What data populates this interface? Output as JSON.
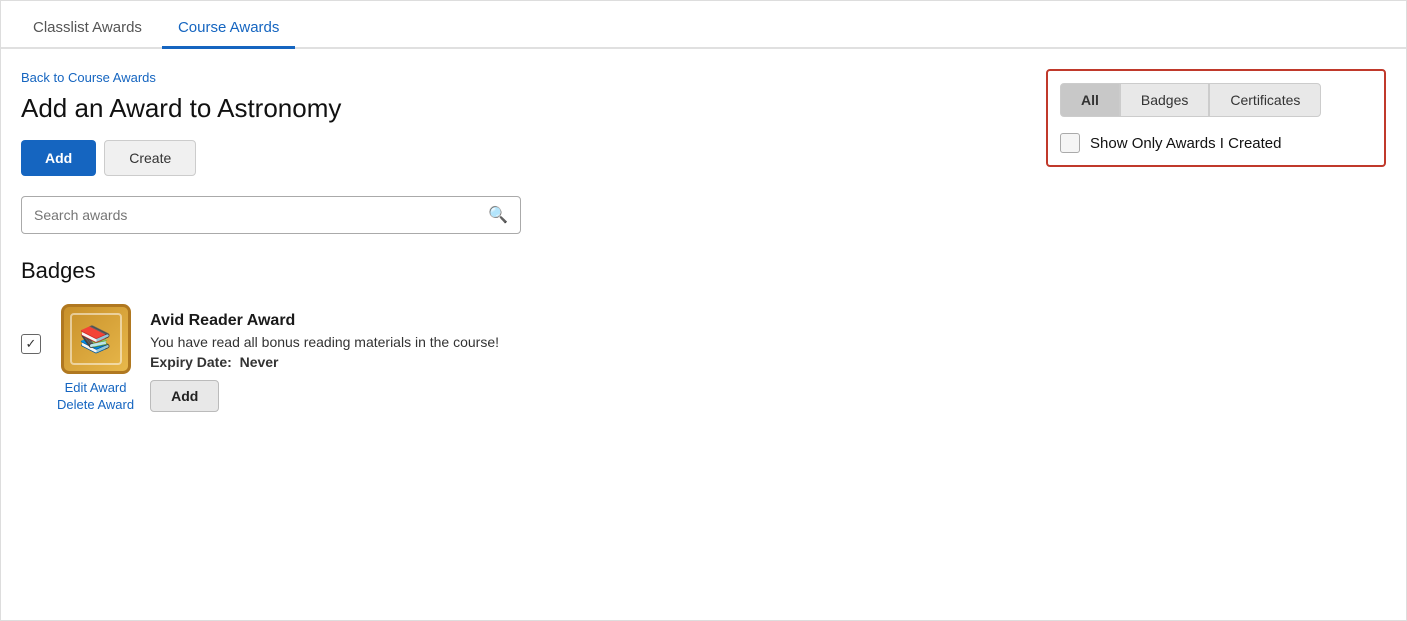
{
  "tabs": [
    {
      "id": "classlist",
      "label": "Classlist Awards",
      "active": false
    },
    {
      "id": "course",
      "label": "Course Awards",
      "active": true
    }
  ],
  "breadcrumb": {
    "back_label": "Back to Course Awards"
  },
  "page_title": "Add an Award to Astronomy",
  "action_buttons": {
    "add_label": "Add",
    "create_label": "Create"
  },
  "search": {
    "placeholder": "Search awards"
  },
  "badges_section": {
    "title": "Badges",
    "items": [
      {
        "id": "avid-reader",
        "checked": true,
        "name": "Avid Reader Award",
        "description": "You have read all bonus reading materials in the course!",
        "expiry_label": "Expiry Date:",
        "expiry_value": "Never",
        "edit_link": "Edit Award",
        "delete_link": "Delete Award",
        "add_button": "Add"
      }
    ]
  },
  "filter_panel": {
    "type_buttons": [
      {
        "id": "all",
        "label": "All",
        "active": true
      },
      {
        "id": "badges",
        "label": "Badges",
        "active": false
      },
      {
        "id": "certificates",
        "label": "Certificates",
        "active": false
      }
    ],
    "show_only": {
      "checked": false,
      "label": "Show Only Awards I Created"
    }
  }
}
